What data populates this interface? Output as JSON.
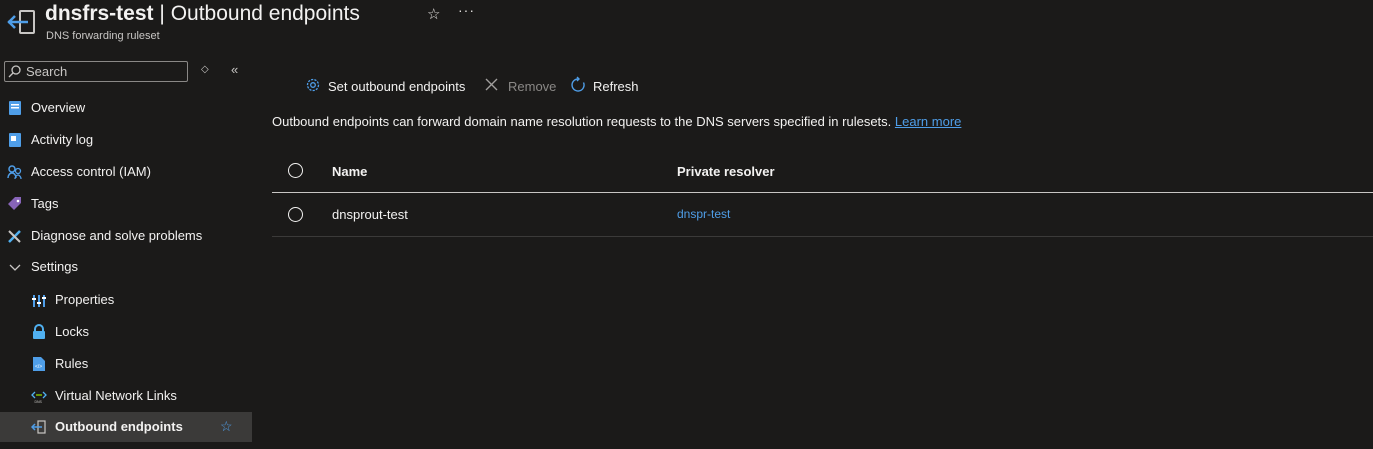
{
  "header": {
    "resource_name": "dnsfrs-test",
    "separator": "|",
    "page_name": "Outbound endpoints",
    "subtitle": "DNS forwarding ruleset",
    "favorite_icon": "star-outline-icon",
    "more_label": "···"
  },
  "search": {
    "placeholder": "Search"
  },
  "sidebar": {
    "items": [
      {
        "label": "Overview",
        "icon": "overview-icon"
      },
      {
        "label": "Activity log",
        "icon": "activity-log-icon"
      },
      {
        "label": "Access control (IAM)",
        "icon": "people-icon"
      },
      {
        "label": "Tags",
        "icon": "tag-icon"
      },
      {
        "label": "Diagnose and solve problems",
        "icon": "wrench-icon"
      },
      {
        "label": "Settings",
        "icon": "chevron-down-icon"
      },
      {
        "label": "Properties",
        "icon": "properties-icon"
      },
      {
        "label": "Locks",
        "icon": "lock-icon"
      },
      {
        "label": "Rules",
        "icon": "rules-icon"
      },
      {
        "label": "Virtual Network Links",
        "icon": "network-link-icon"
      },
      {
        "label": "Outbound endpoints",
        "icon": "outbound-endpoint-icon",
        "active": true
      }
    ]
  },
  "toolbar": {
    "set_label": "Set outbound endpoints",
    "remove_label": "Remove",
    "refresh_label": "Refresh"
  },
  "description": {
    "text": "Outbound endpoints can forward domain name resolution requests to the DNS servers specified in rulesets.",
    "link": "Learn more"
  },
  "table": {
    "columns": [
      "Name",
      "Private resolver"
    ],
    "rows": [
      {
        "name": "dnsprout-test",
        "private_resolver": "dnspr-test"
      }
    ]
  },
  "colors": {
    "background": "#1b1a19",
    "accent": "#4f9ee8",
    "active_row": "#3b3a39"
  }
}
